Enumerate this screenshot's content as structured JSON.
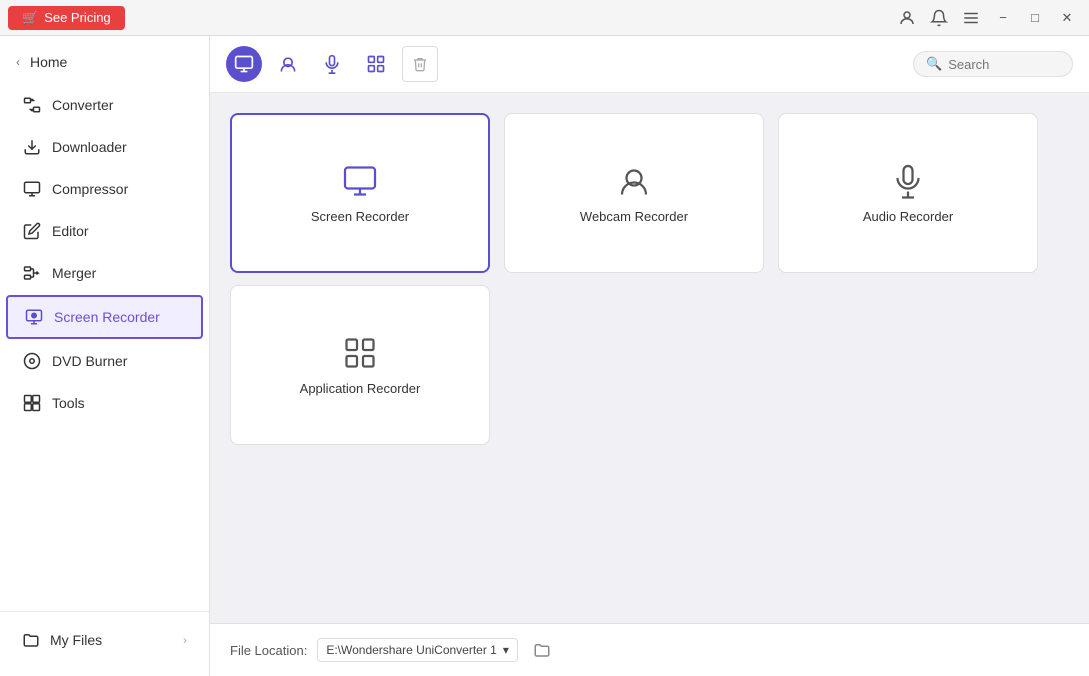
{
  "titlebar": {
    "see_pricing_label": "See Pricing",
    "minimize_title": "Minimize",
    "maximize_title": "Maximize",
    "close_title": "Close"
  },
  "sidebar": {
    "home_label": "Home",
    "items": [
      {
        "id": "converter",
        "label": "Converter"
      },
      {
        "id": "downloader",
        "label": "Downloader"
      },
      {
        "id": "compressor",
        "label": "Compressor"
      },
      {
        "id": "editor",
        "label": "Editor"
      },
      {
        "id": "merger",
        "label": "Merger"
      },
      {
        "id": "screen-recorder",
        "label": "Screen Recorder",
        "active": true
      },
      {
        "id": "dvd-burner",
        "label": "DVD Burner"
      },
      {
        "id": "tools",
        "label": "Tools"
      }
    ],
    "my_files_label": "My Files"
  },
  "toolbar": {
    "tabs": [
      {
        "id": "screen",
        "icon": "screen"
      },
      {
        "id": "webcam",
        "icon": "webcam"
      },
      {
        "id": "audio",
        "icon": "audio"
      },
      {
        "id": "apprecorder",
        "icon": "apps"
      }
    ],
    "trash_label": "Delete",
    "search_placeholder": "Search"
  },
  "recorder_cards": [
    {
      "id": "screen-recorder",
      "label": "Screen Recorder",
      "selected": true
    },
    {
      "id": "webcam-recorder",
      "label": "Webcam Recorder",
      "selected": false
    },
    {
      "id": "audio-recorder",
      "label": "Audio Recorder",
      "selected": false
    },
    {
      "id": "application-recorder",
      "label": "Application Recorder",
      "selected": false
    }
  ],
  "bottom_bar": {
    "file_location_label": "File Location:",
    "file_path": "E:\\Wondershare UniConverter 1",
    "dropdown_arrow": "▾"
  }
}
